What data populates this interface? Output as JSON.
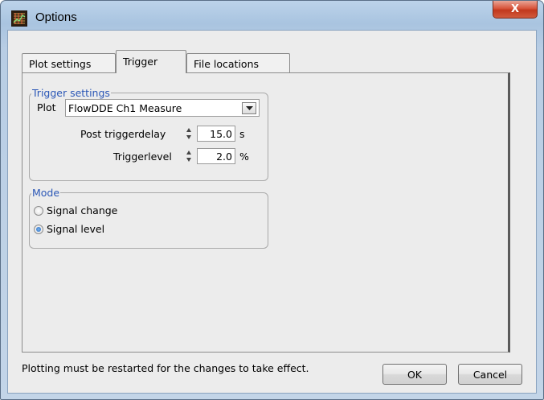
{
  "window": {
    "title": "Options",
    "close_symbol": "X",
    "app_icon": "chart-grid-icon"
  },
  "tabs": [
    {
      "label": "Plot settings",
      "active": false
    },
    {
      "label": "Trigger",
      "active": true
    },
    {
      "label": "File locations",
      "active": false
    }
  ],
  "trigger_settings": {
    "title": "Trigger settings",
    "plot_label": "Plot",
    "plot_value": "FlowDDE Ch1 Measure",
    "post_delay_label": "Post triggerdelay",
    "post_delay_value": "15.0",
    "post_delay_unit": "s",
    "level_label": "Triggerlevel",
    "level_value": "2.0",
    "level_unit": "%"
  },
  "mode": {
    "title": "Mode",
    "options": [
      {
        "label": "Signal change",
        "checked": false
      },
      {
        "label": "Signal level",
        "checked": true
      }
    ]
  },
  "note": "Plotting must be restarted for the changes to take effect.",
  "buttons": {
    "ok": "OK",
    "cancel": "Cancel"
  },
  "colors": {
    "group_title": "#2b57b6",
    "close_button": "#c1381d",
    "radio_selected": "#1f66c2"
  }
}
